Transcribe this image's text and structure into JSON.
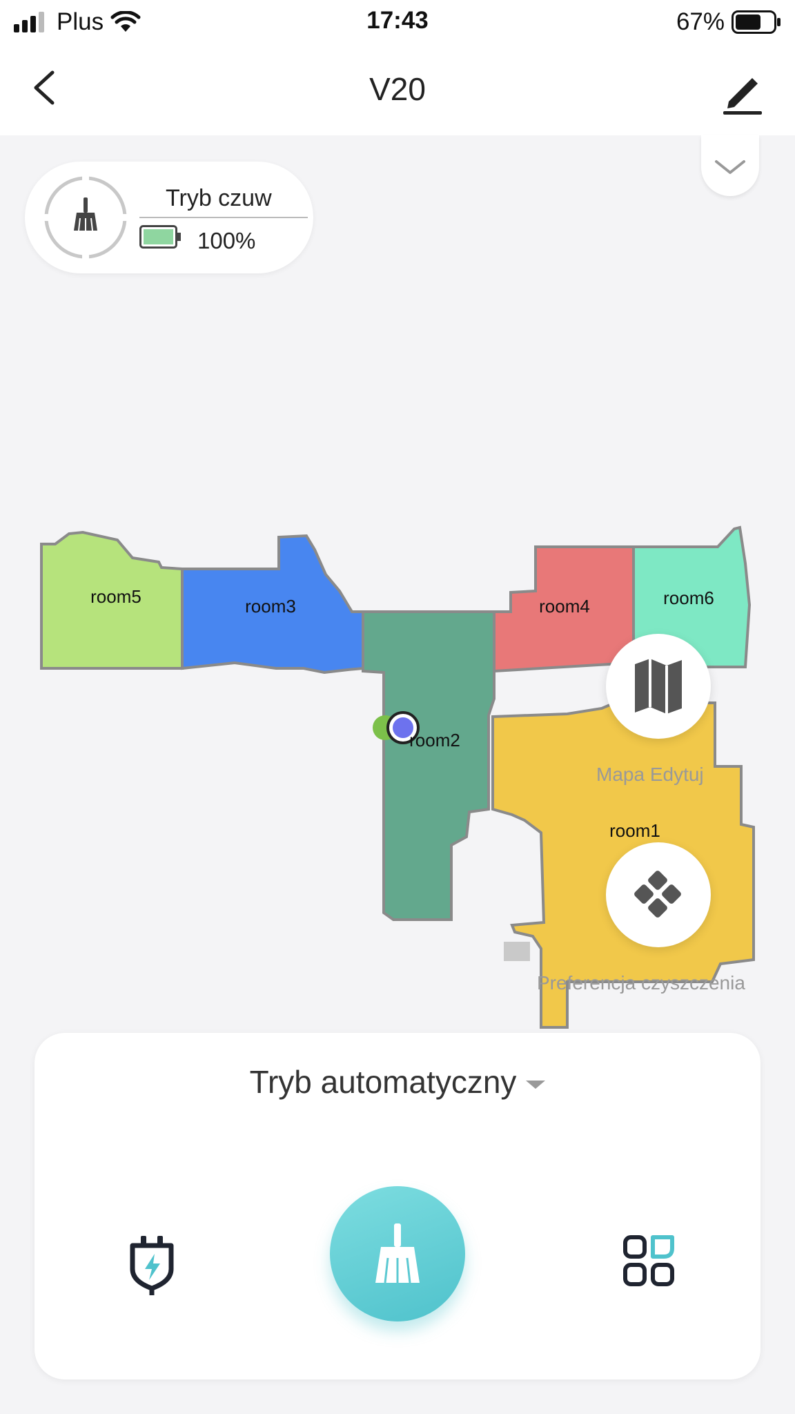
{
  "status_bar": {
    "carrier": "Plus",
    "time": "17:43",
    "battery_percent": "67%",
    "battery_level": 0.67
  },
  "nav": {
    "title": "V20",
    "back_icon": "chevron-left-icon",
    "edit_icon": "pencil-icon"
  },
  "robot_status": {
    "mode": "Tryb czuw",
    "battery": "100%",
    "icon": "broom-icon"
  },
  "map": {
    "rooms": [
      {
        "name": "room5",
        "color": "#b6e37c"
      },
      {
        "name": "room3",
        "color": "#4886f0"
      },
      {
        "name": "room2",
        "color": "#63a88d"
      },
      {
        "name": "room4",
        "color": "#e87878"
      },
      {
        "name": "room6",
        "color": "#7ee8c4"
      },
      {
        "name": "room1",
        "color": "#f1c84a"
      }
    ],
    "edit_map_label": "Mapa Edytuj",
    "preferences_label": "Preferencja czyszczenia"
  },
  "controls": {
    "mode_select": "Tryb automatyczny",
    "dock_icon": "dock-charge-icon",
    "clean_icon": "broom-icon",
    "rooms_icon": "room-select-icon",
    "accent": "#5cc9d2"
  }
}
